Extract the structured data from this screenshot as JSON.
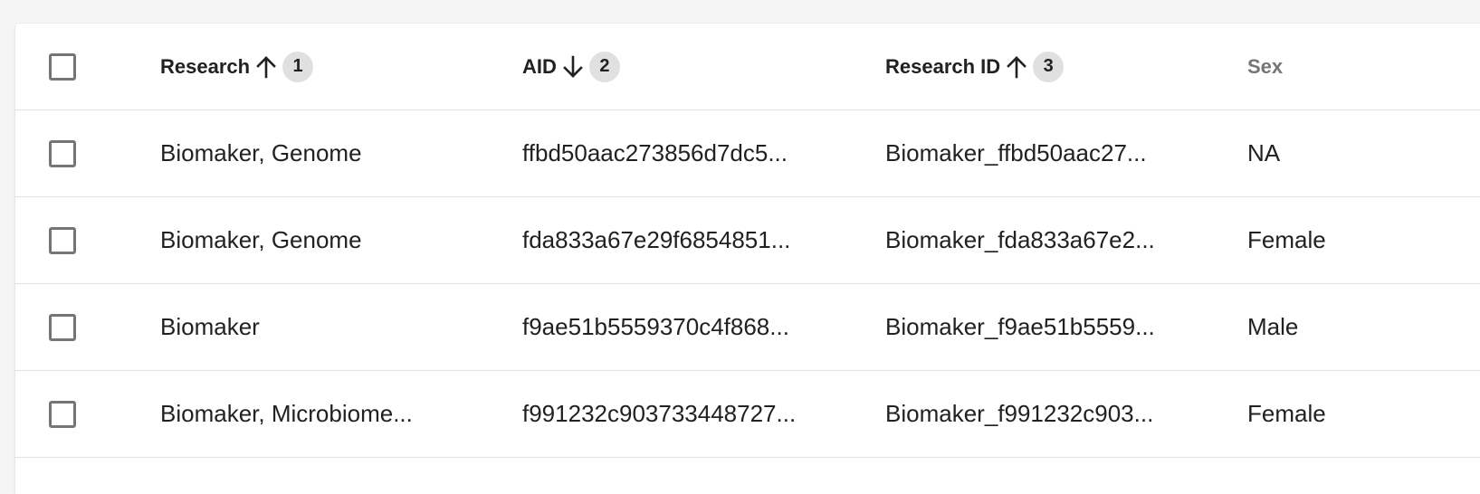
{
  "header": {
    "select_all_checked": false,
    "columns": [
      {
        "label": "Research",
        "sort_direction": "ascending",
        "sort_order": "1",
        "icon": "arrow-up-icon"
      },
      {
        "label": "AID",
        "sort_direction": "descending",
        "sort_order": "2",
        "icon": "arrow-down-icon"
      },
      {
        "label": "Research ID",
        "sort_direction": "ascending",
        "sort_order": "3",
        "icon": "arrow-up-icon"
      },
      {
        "label": "Sex"
      }
    ]
  },
  "rows": [
    {
      "checked": false,
      "research": "Biomaker, Genome",
      "aid": "ffbd50aac273856d7dc5...",
      "research_id": "Biomaker_ffbd50aac27...",
      "sex": "NA"
    },
    {
      "checked": false,
      "research": "Biomaker, Genome",
      "aid": "fda833a67e29f6854851...",
      "research_id": "Biomaker_fda833a67e2...",
      "sex": "Female"
    },
    {
      "checked": false,
      "research": "Biomaker",
      "aid": "f9ae51b5559370c4f868...",
      "research_id": "Biomaker_f9ae51b5559...",
      "sex": "Male"
    },
    {
      "checked": false,
      "research": "Biomaker, Microbiome...",
      "aid": "f991232c903733448727...",
      "research_id": "Biomaker_f991232c903...",
      "sex": "Female"
    }
  ],
  "colors": {
    "page_background": "#f5f5f5",
    "surface": "#ffffff",
    "text": "#212121",
    "muted_header": "#757575",
    "divider": "#e0e0e0",
    "badge": "#e0e0e0",
    "checkbox_border": "#757575"
  }
}
